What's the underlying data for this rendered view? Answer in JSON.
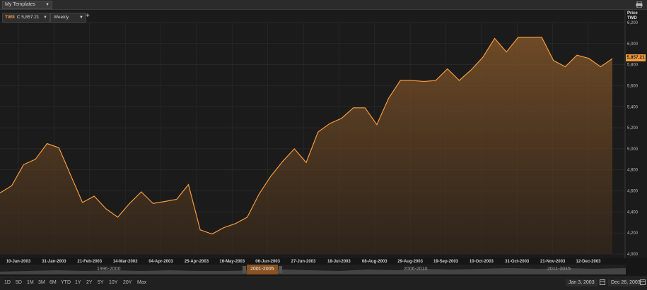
{
  "toolbar": {
    "templates_label": "My Templates"
  },
  "chart_controls": {
    "ric": "TWII",
    "ric_value": "C 5,857.21",
    "period": "Weekly",
    "add_label": "+"
  },
  "y_axis": {
    "title1": "Price",
    "title2": "TWD"
  },
  "last_price_label": "5,857.21",
  "colors": {
    "line": "#f39a3c",
    "background": "#1b1b1b",
    "grid": "#2e2e2e"
  },
  "chart_data": {
    "type": "area",
    "title": "",
    "xlabel": "",
    "ylabel": "Price TWD",
    "ylim": [
      4000,
      6200
    ],
    "yticks": [
      4000,
      4200,
      4400,
      4600,
      4800,
      5000,
      5200,
      5400,
      5600,
      5800,
      6000,
      6200
    ],
    "ytick_labels": [
      "4,000",
      "4,200",
      "4,400",
      "4,600",
      "4,800",
      "5,000",
      "5,200",
      "5,400",
      "5,600",
      "5,800",
      "6,000",
      "6,200"
    ],
    "xtick_labels": [
      "10-Jan-2003",
      "31-Jan-2003",
      "21-Feb-2003",
      "14-Mar-2003",
      "04-Apr-2003",
      "25-Apr-2003",
      "16-May-2003",
      "06-Jun-2003",
      "27-Jun-2003",
      "18-Jul-2003",
      "08-Aug-2003",
      "29-Aug-2003",
      "19-Sep-2003",
      "10-Oct-2003",
      "31-Oct-2003",
      "21-Nov-2003",
      "12-Dec-2003"
    ],
    "series": [
      {
        "values": [
          4580,
          4650,
          4850,
          4900,
          5050,
          5010,
          4750,
          4490,
          4550,
          4430,
          4350,
          4480,
          4590,
          4480,
          4500,
          4520,
          4660,
          4230,
          4190,
          4250,
          4290,
          4350,
          4570,
          4740,
          4880,
          5000,
          4870,
          5160,
          5240,
          5290,
          5390,
          5390,
          5230,
          5480,
          5650,
          5650,
          5640,
          5650,
          5760,
          5650,
          5750,
          5870,
          6050,
          5920,
          6060,
          6060,
          6060,
          5840,
          5780,
          5890,
          5860,
          5780,
          5857.21
        ]
      }
    ],
    "grid": true,
    "legend": "none"
  },
  "navigator": {
    "ranges": [
      "1996-2000",
      "2001-2005",
      "2006-2010",
      "2011-2015"
    ]
  },
  "range_buttons": [
    "1D",
    "5D",
    "1M",
    "3M",
    "6M",
    "YTD",
    "1Y",
    "2Y",
    "5Y",
    "10Y",
    "20Y",
    "Max"
  ],
  "date_range": {
    "start": "Jan 3, 2003",
    "end": "Dec 26, 2003"
  }
}
